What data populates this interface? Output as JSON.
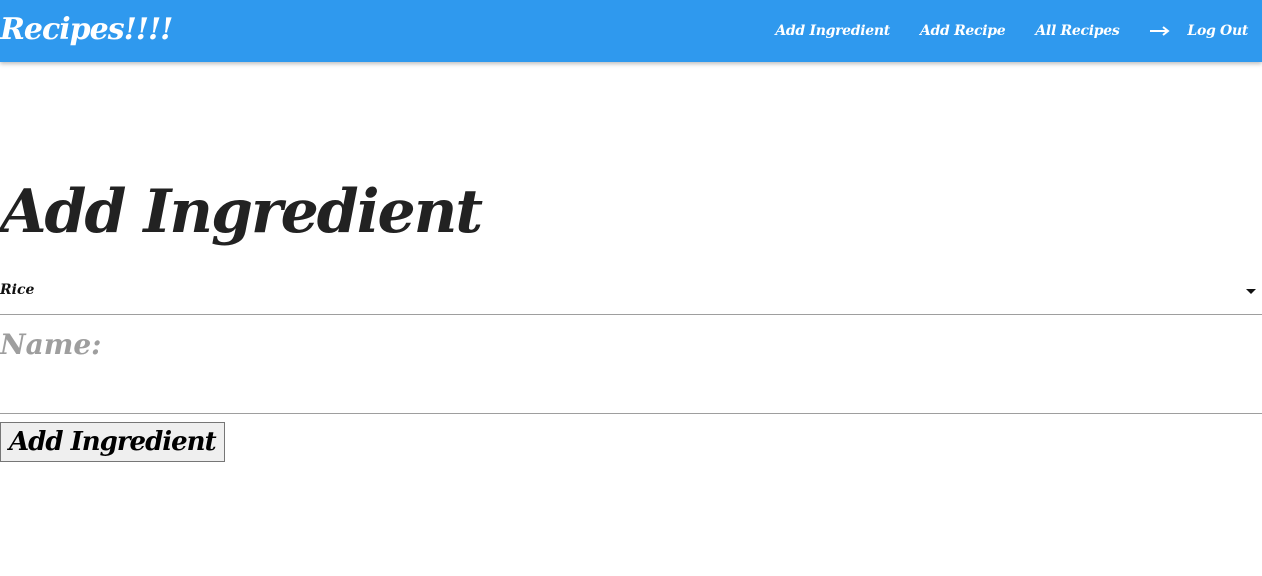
{
  "header": {
    "brand": "Recipes!!!!",
    "nav": [
      {
        "label": "Add Ingredient"
      },
      {
        "label": "Add Recipe"
      },
      {
        "label": "All Recipes"
      }
    ],
    "logout_label": "Log Out",
    "logout_icon": "arrow-right-icon",
    "background_color": "#2f99ee"
  },
  "main": {
    "title": "Add Ingredient",
    "ingredient_select": {
      "selected": "Rice"
    },
    "name_field": {
      "label": "Name:",
      "value": ""
    },
    "submit_label": "Add Ingredient"
  }
}
